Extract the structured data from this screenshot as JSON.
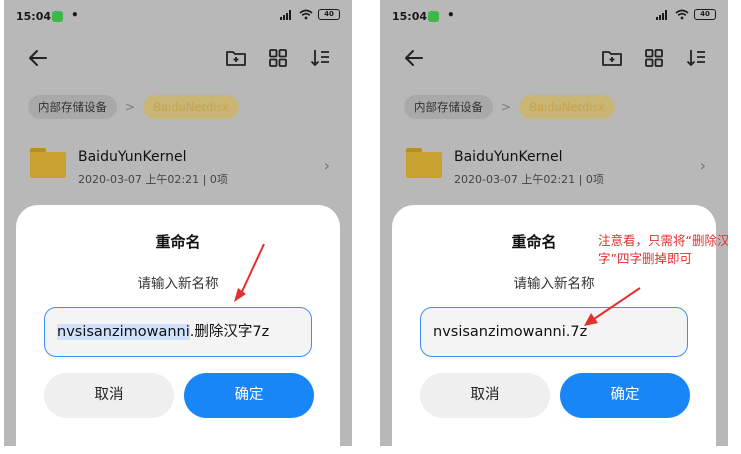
{
  "status": {
    "time": "15:04",
    "dot": "•",
    "battery": "40"
  },
  "breadcrumb": {
    "root": "内部存储设备",
    "separator": ">",
    "current": "BaiduNetdisk"
  },
  "folder": {
    "name": "BaiduYunKernel",
    "meta": "2020-03-07 上午02:21 | 0项"
  },
  "dialog_left": {
    "title": "重命名",
    "subtitle": "请输入新名称",
    "input_selected": "nvsisanzimowanni",
    "input_rest": ".删除汉字7z",
    "cancel_label": "取消",
    "ok_label": "确定"
  },
  "dialog_right": {
    "title": "重命名",
    "subtitle": "请输入新名称",
    "input_value": "nvsisanzimowanni.7z",
    "cancel_label": "取消",
    "ok_label": "确定"
  },
  "annotation": "注意看，只需将“删除汉字”四字删掉即可",
  "colors": {
    "accent": "#1886F6",
    "annotation": "#E23030",
    "folder": "#C8A030",
    "overlay": "#B8B8B8"
  },
  "icons": [
    "back-arrow-icon",
    "new-folder-icon",
    "grid-view-icon",
    "sort-icon",
    "chevron-right-icon",
    "folder-icon",
    "signal-icon",
    "wifi-icon",
    "battery-icon"
  ]
}
